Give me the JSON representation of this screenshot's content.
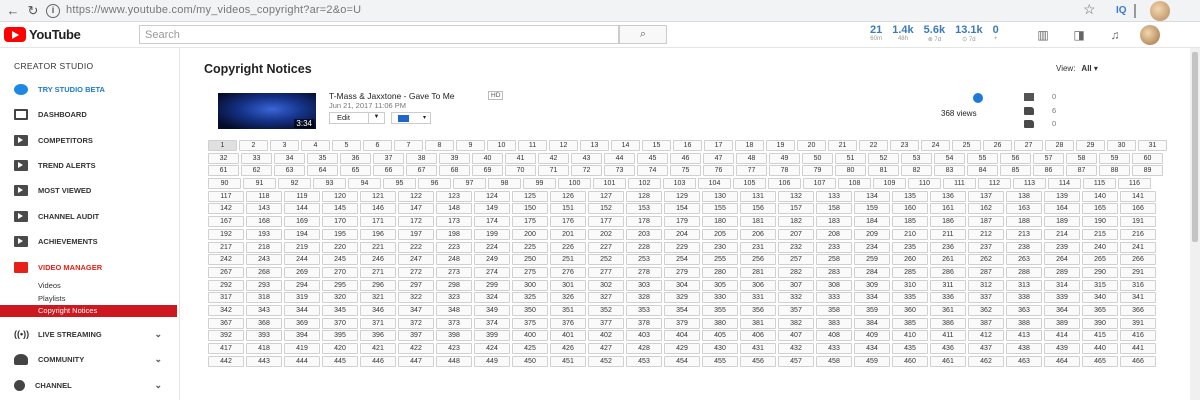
{
  "browser": {
    "url": "https://www.youtube.com/my_videos_copyright?ar=2&o=U"
  },
  "header": {
    "logo_text": "YouTube",
    "search_placeholder": "Search",
    "stats": [
      {
        "value": "21",
        "label": "60m"
      },
      {
        "value": "1.4k",
        "label": "48h"
      },
      {
        "value": "5.6k",
        "label": "⊗ 7d"
      },
      {
        "value": "13.1k",
        "label": "⊙ 7d"
      },
      {
        "value": "0",
        "label": "+"
      }
    ]
  },
  "sidebar": {
    "title": "CREATOR STUDIO",
    "items": [
      {
        "label": "TRY STUDIO BETA",
        "icon": "gear-icon",
        "style": "blue"
      },
      {
        "label": "DASHBOARD",
        "icon": "dashboard-icon"
      },
      {
        "label": "COMPETITORS",
        "icon": "video-icon"
      },
      {
        "label": "TREND ALERTS",
        "icon": "video-icon"
      },
      {
        "label": "MOST VIEWED",
        "icon": "video-icon"
      },
      {
        "label": "CHANNEL AUDIT",
        "icon": "video-icon"
      },
      {
        "label": "ACHIEVEMENTS",
        "icon": "video-icon"
      },
      {
        "label": "VIDEO MANAGER",
        "icon": "video-manager-icon",
        "style": "red"
      }
    ],
    "sub_items": [
      "Videos",
      "Playlists",
      "Copyright Notices"
    ],
    "bottom_items": [
      {
        "label": "LIVE STREAMING",
        "icon": "live-icon"
      },
      {
        "label": "COMMUNITY",
        "icon": "community-icon"
      },
      {
        "label": "CHANNEL",
        "icon": "channel-icon"
      }
    ]
  },
  "main": {
    "title": "Copyright Notices",
    "view_label": "View:",
    "view_value": "All",
    "video": {
      "title": "T-Mass & Jaxxtone - Gave To Me",
      "hd_badge": "HD",
      "date": "Jun 21, 2017 11:06 PM",
      "duration": "3:34",
      "edit_label": "Edit",
      "views": "368 views",
      "comments": "0",
      "likes": "6",
      "dislikes": "0"
    }
  },
  "pagination": {
    "first": 1,
    "last": 466,
    "active": 1,
    "rows": [
      [
        1,
        31
      ],
      [
        32,
        60
      ],
      [
        61,
        89
      ],
      [
        90,
        116
      ],
      [
        117,
        141
      ],
      [
        142,
        166
      ],
      [
        167,
        191
      ],
      [
        192,
        216
      ],
      [
        217,
        241
      ],
      [
        242,
        266
      ],
      [
        267,
        291
      ],
      [
        292,
        316
      ],
      [
        317,
        341
      ],
      [
        342,
        366
      ],
      [
        367,
        391
      ],
      [
        392,
        416
      ],
      [
        417,
        441
      ],
      [
        442,
        466
      ]
    ]
  }
}
